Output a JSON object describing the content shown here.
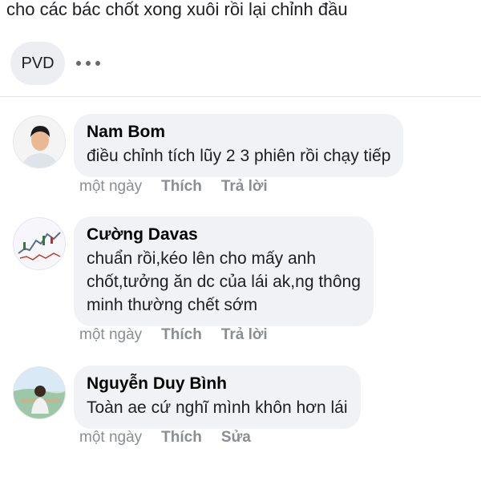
{
  "post": {
    "text": "cho các bác chốt xong xuôi rồi lại chỉnh đầu",
    "tag_chip": "PVD",
    "more_icon": "more-horizontal-icon"
  },
  "comments": [
    {
      "author": "Nam Bom",
      "lines": [
        "điều chỉnh tích lũy 2 3 phiên rồi chạy tiếp"
      ],
      "time": "một ngày",
      "like_label": "Thích",
      "secondary_label": "Trả lời"
    },
    {
      "author": "Cường Davas",
      "lines": [
        "chuẩn rồi,kéo lên cho mấy anh",
        "chốt,tưởng ăn dc của lái ak,ng thông",
        "minh thường chết sớm"
      ],
      "time": "một ngày",
      "like_label": "Thích",
      "secondary_label": "Trả lời"
    },
    {
      "author": "Nguyễn Duy Bình",
      "lines": [
        "Toàn ae cứ nghĩ mình khôn hơn lái"
      ],
      "time": "một ngày",
      "like_label": "Thích",
      "secondary_label": "Sửa"
    }
  ]
}
